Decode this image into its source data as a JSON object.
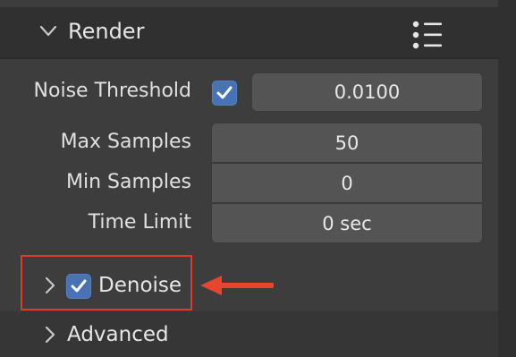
{
  "render_panel": {
    "title": "Render",
    "noise_threshold": {
      "label": "Noise Threshold",
      "enabled": true,
      "value": "0.0100"
    },
    "max_samples": {
      "label": "Max Samples",
      "value": "50"
    },
    "min_samples": {
      "label": "Min Samples",
      "value": "0"
    },
    "time_limit": {
      "label": "Time Limit",
      "value": "0 sec"
    },
    "denoise": {
      "label": "Denoise",
      "enabled": true,
      "expanded": false
    },
    "advanced": {
      "label": "Advanced",
      "expanded": false
    }
  },
  "icons": {
    "header_chevron": "chevron-down-icon",
    "menu": "list-menu-icon",
    "sub_chevron": "chevron-right-icon",
    "check": "checkmark-icon",
    "annotation": "arrow-left-icon"
  },
  "colors": {
    "background": "#3d3d3d",
    "header": "#303030",
    "field": "#545454",
    "checkbox": "#4772b3",
    "annotation": "#e0392e"
  }
}
